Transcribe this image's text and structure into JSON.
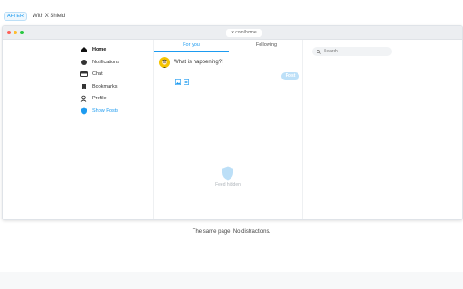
{
  "header": {
    "badge": "AFTER",
    "caption": "With X Shield"
  },
  "browser": {
    "url": "x.com/home",
    "colors": {
      "close": "#ff5f57",
      "minimize": "#febc2e",
      "maximize": "#28c840"
    }
  },
  "sidebar": {
    "items": [
      {
        "label": "Home",
        "icon": "home-icon"
      },
      {
        "label": "Notifications",
        "icon": "bell-icon"
      },
      {
        "label": "Chat",
        "icon": "chat-icon"
      },
      {
        "label": "Bookmarks",
        "icon": "bookmark-icon"
      },
      {
        "label": "Profile",
        "icon": "person-icon"
      },
      {
        "label": "Show Posts",
        "icon": "shield-icon"
      }
    ]
  },
  "feed": {
    "tabs": [
      {
        "label": "For you"
      },
      {
        "label": "Following"
      }
    ],
    "composer": {
      "placeholder": "What is happening?!",
      "post_label": "Post"
    },
    "hidden_text": "Feed hidden"
  },
  "right_panel": {
    "search_placeholder": "Search"
  },
  "caption": "The same page. No distractions.",
  "accent_color": "#1d9bf0"
}
